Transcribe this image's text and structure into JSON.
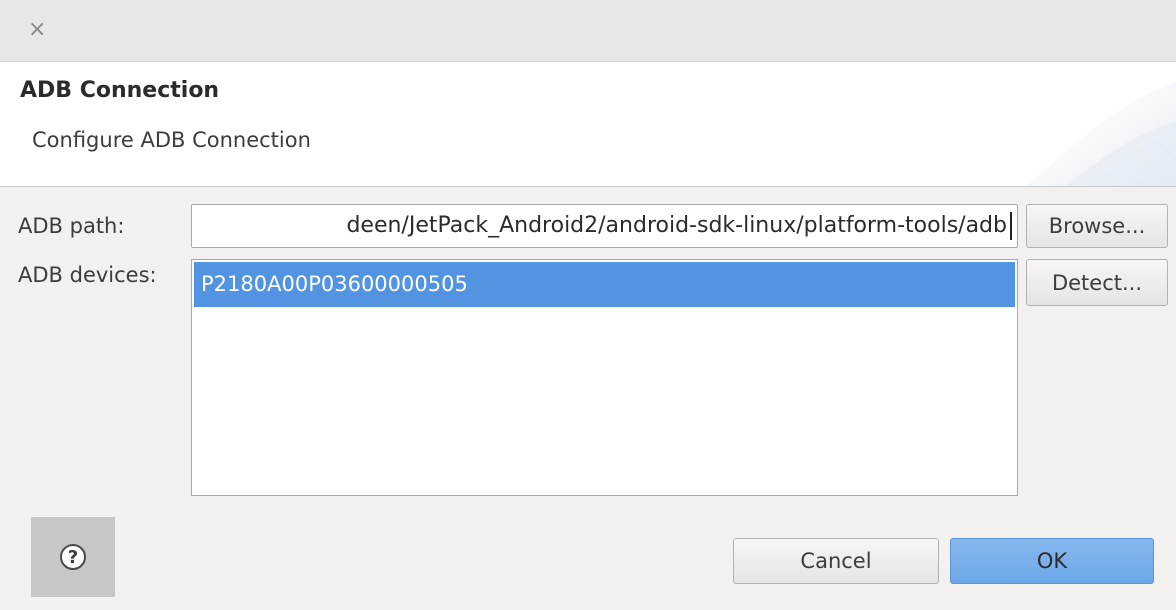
{
  "titlebar": {
    "close_glyph": "×"
  },
  "header": {
    "title": "ADB Connection",
    "subtitle": "Configure ADB Connection"
  },
  "form": {
    "path_label": "ADB path:",
    "path_value": "deen/JetPack_Android2/android-sdk-linux/platform-tools/adb",
    "browse_label": "Browse...",
    "devices_label": "ADB devices:",
    "devices": [
      "P2180A00P03600000505"
    ],
    "detect_label": "Detect..."
  },
  "footer": {
    "help_glyph": "?",
    "cancel_label": "Cancel",
    "ok_label": "OK"
  },
  "colors": {
    "selection": "#5294e2",
    "ok_button": "#6ea7e8",
    "background": "#f2f1f0"
  }
}
